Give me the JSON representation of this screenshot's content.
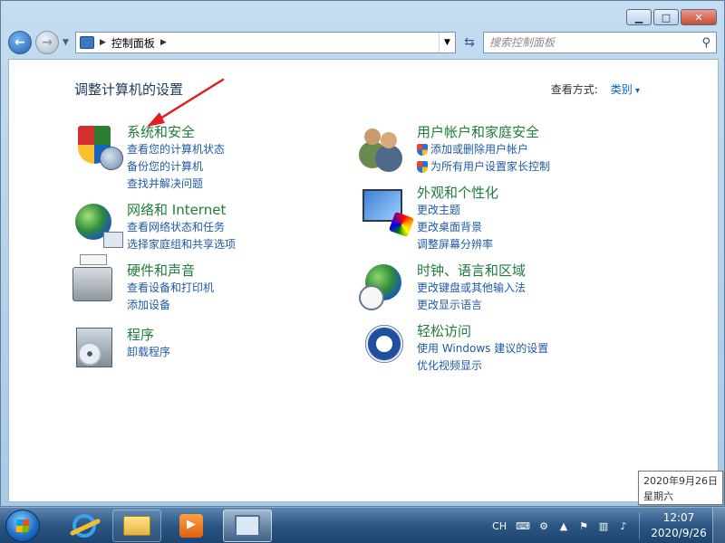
{
  "address": {
    "path": "控制面板",
    "search_placeholder": "搜索控制面板"
  },
  "header": {
    "title": "调整计算机的设置",
    "view_label": "查看方式:",
    "view_value": "类别"
  },
  "categories": {
    "system": {
      "title": "系统和安全",
      "links": [
        "查看您的计算机状态",
        "备份您的计算机",
        "查找并解决问题"
      ]
    },
    "network": {
      "title": "网络和 Internet",
      "links": [
        "查看网络状态和任务",
        "选择家庭组和共享选项"
      ]
    },
    "hardware": {
      "title": "硬件和声音",
      "links": [
        "查看设备和打印机",
        "添加设备"
      ]
    },
    "programs": {
      "title": "程序",
      "links": [
        "卸载程序"
      ]
    },
    "users": {
      "title": "用户帐户和家庭安全",
      "links": [
        "添加或删除用户帐户",
        "为所有用户设置家长控制"
      ]
    },
    "appearance": {
      "title": "外观和个性化",
      "links": [
        "更改主题",
        "更改桌面背景",
        "调整屏幕分辨率"
      ]
    },
    "clock": {
      "title": "时钟、语言和区域",
      "links": [
        "更改键盘或其他输入法",
        "更改显示语言"
      ]
    },
    "ease": {
      "title": "轻松访问",
      "links": [
        "使用 Windows 建议的设置",
        "优化视频显示"
      ]
    }
  },
  "tooltip": {
    "line1": "2020年9月26日",
    "line2": "星期六"
  },
  "taskbar": {
    "lang": "CH",
    "time": "12:07",
    "date": "2020/9/26"
  },
  "colors": {
    "category_title": "#1e7d3a",
    "link": "#1f5aa6",
    "annotation_arrow": "#e02020"
  }
}
